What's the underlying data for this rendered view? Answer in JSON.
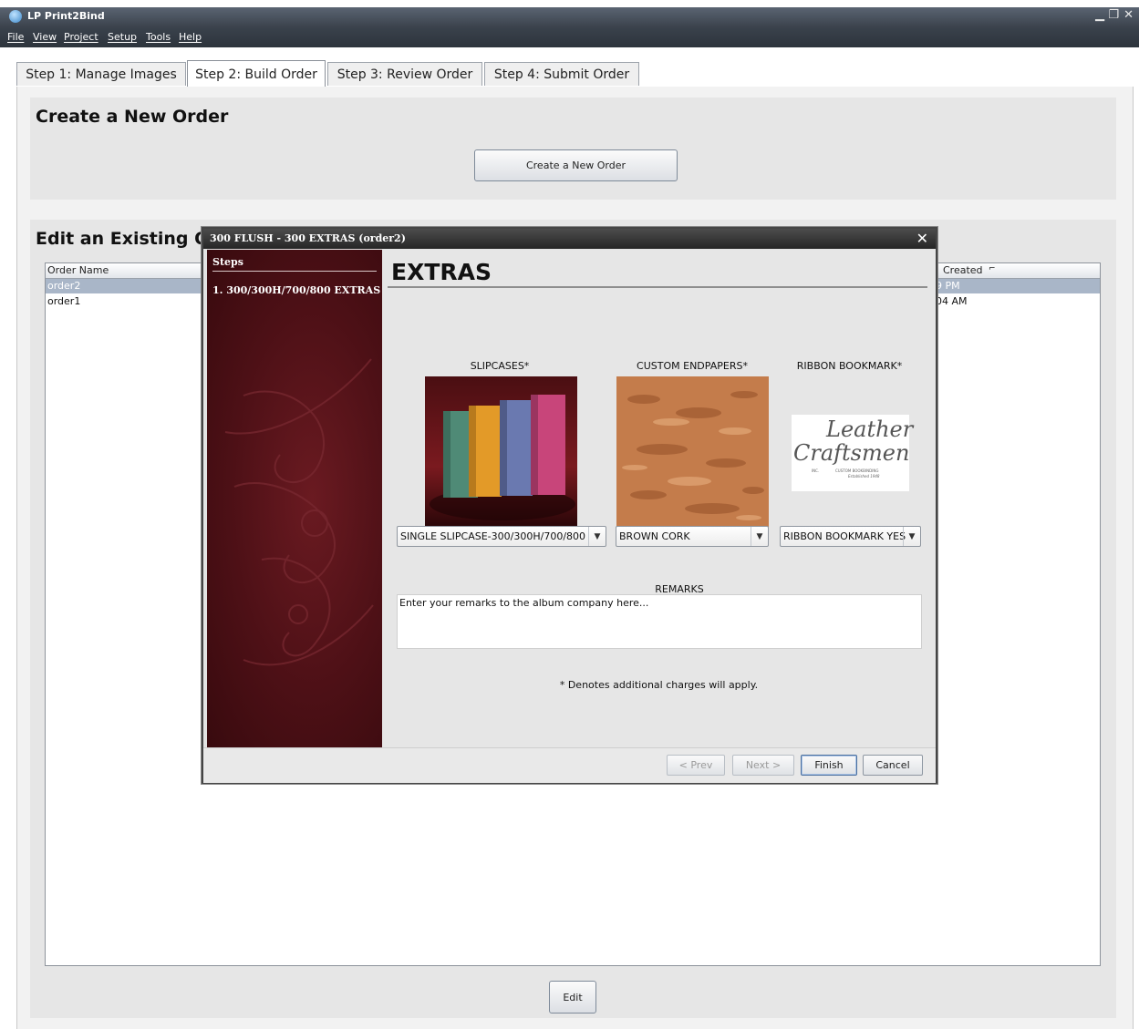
{
  "app": {
    "title": "LP Print2Bind"
  },
  "menu": [
    "File",
    "View",
    "Project",
    "Setup",
    "Tools",
    "Help"
  ],
  "tabs": [
    {
      "label": "Step 1: Manage Images"
    },
    {
      "label": "Step 2: Build Order",
      "active": true
    },
    {
      "label": "Step 3: Review Order"
    },
    {
      "label": "Step 4: Submit Order"
    }
  ],
  "create_section": {
    "title": "Create a New Order",
    "button": "Create a New Order"
  },
  "edit_section": {
    "title": "Edit an Existing Or",
    "columns": [
      "Order Name",
      "Created"
    ],
    "rows": [
      {
        "name": "order2",
        "created": "9 PM",
        "selected": true
      },
      {
        "name": "order1",
        "created": "04 AM",
        "selected": false
      }
    ],
    "button": "Edit"
  },
  "dialog": {
    "title": "300 FLUSH - 300 EXTRAS (order2)",
    "steps_header": "Steps",
    "steps": [
      "1. 300/300H/700/800 EXTRAS"
    ],
    "heading": "EXTRAS",
    "slipcases": {
      "label": "SLIPCASES*",
      "value": "SINGLE SLIPCASE-300/300H/700/800"
    },
    "endpapers": {
      "label": "CUSTOM ENDPAPERS*",
      "value": "BROWN CORK"
    },
    "bookmark": {
      "label": "RIBBON BOOKMARK*",
      "value": "RIBBON BOOKMARK YES"
    },
    "logo": {
      "line1": "Leather",
      "line2": "Craftsmen",
      "tag": "CUSTOM BOOKBINDING",
      "est": "Established 1948",
      "inc": "INC."
    },
    "remarks_label": "REMARKS",
    "remarks_placeholder": "Enter your remarks to the album company here...",
    "note": "* Denotes additional charges will apply.",
    "buttons": {
      "prev": "< Prev",
      "next": "Next >",
      "finish": "Finish",
      "cancel": "Cancel"
    }
  },
  "colors": {
    "accent_dark_red": "#4d1016",
    "selection": "#a9b6c8"
  }
}
